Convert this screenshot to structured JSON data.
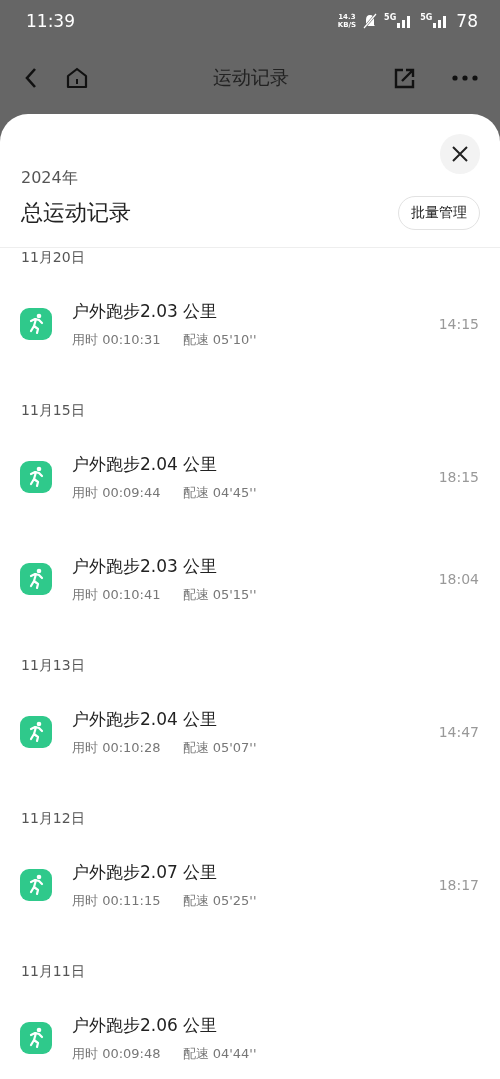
{
  "status_bar": {
    "time": "11:39",
    "speed_value": "14.3",
    "speed_unit": "KB/S",
    "network_1": "5G",
    "network_2": "5G",
    "battery": "78"
  },
  "nav": {
    "title": "运动记录"
  },
  "sheet": {
    "year": "2024年",
    "title": "总运动记录",
    "manage_button": "批量管理"
  },
  "groups": [
    {
      "date": "11月20日",
      "records": [
        {
          "title": "户外跑步2.03 公里",
          "duration": "用时 00:10:31",
          "pace": "配速 05'10''",
          "time": "14:15"
        }
      ]
    },
    {
      "date": "11月15日",
      "records": [
        {
          "title": "户外跑步2.04 公里",
          "duration": "用时 00:09:44",
          "pace": "配速 04'45''",
          "time": "18:15"
        },
        {
          "title": "户外跑步2.03 公里",
          "duration": "用时 00:10:41",
          "pace": "配速 05'15''",
          "time": "18:04"
        }
      ]
    },
    {
      "date": "11月13日",
      "records": [
        {
          "title": "户外跑步2.04 公里",
          "duration": "用时 00:10:28",
          "pace": "配速 05'07''",
          "time": "14:47"
        }
      ]
    },
    {
      "date": "11月12日",
      "records": [
        {
          "title": "户外跑步2.07 公里",
          "duration": "用时 00:11:15",
          "pace": "配速 05'25''",
          "time": "18:17"
        }
      ]
    },
    {
      "date": "11月11日",
      "records": [
        {
          "title": "户外跑步2.06 公里",
          "duration": "用时 00:09:48",
          "pace": "配速 04'44''"
        }
      ]
    }
  ]
}
